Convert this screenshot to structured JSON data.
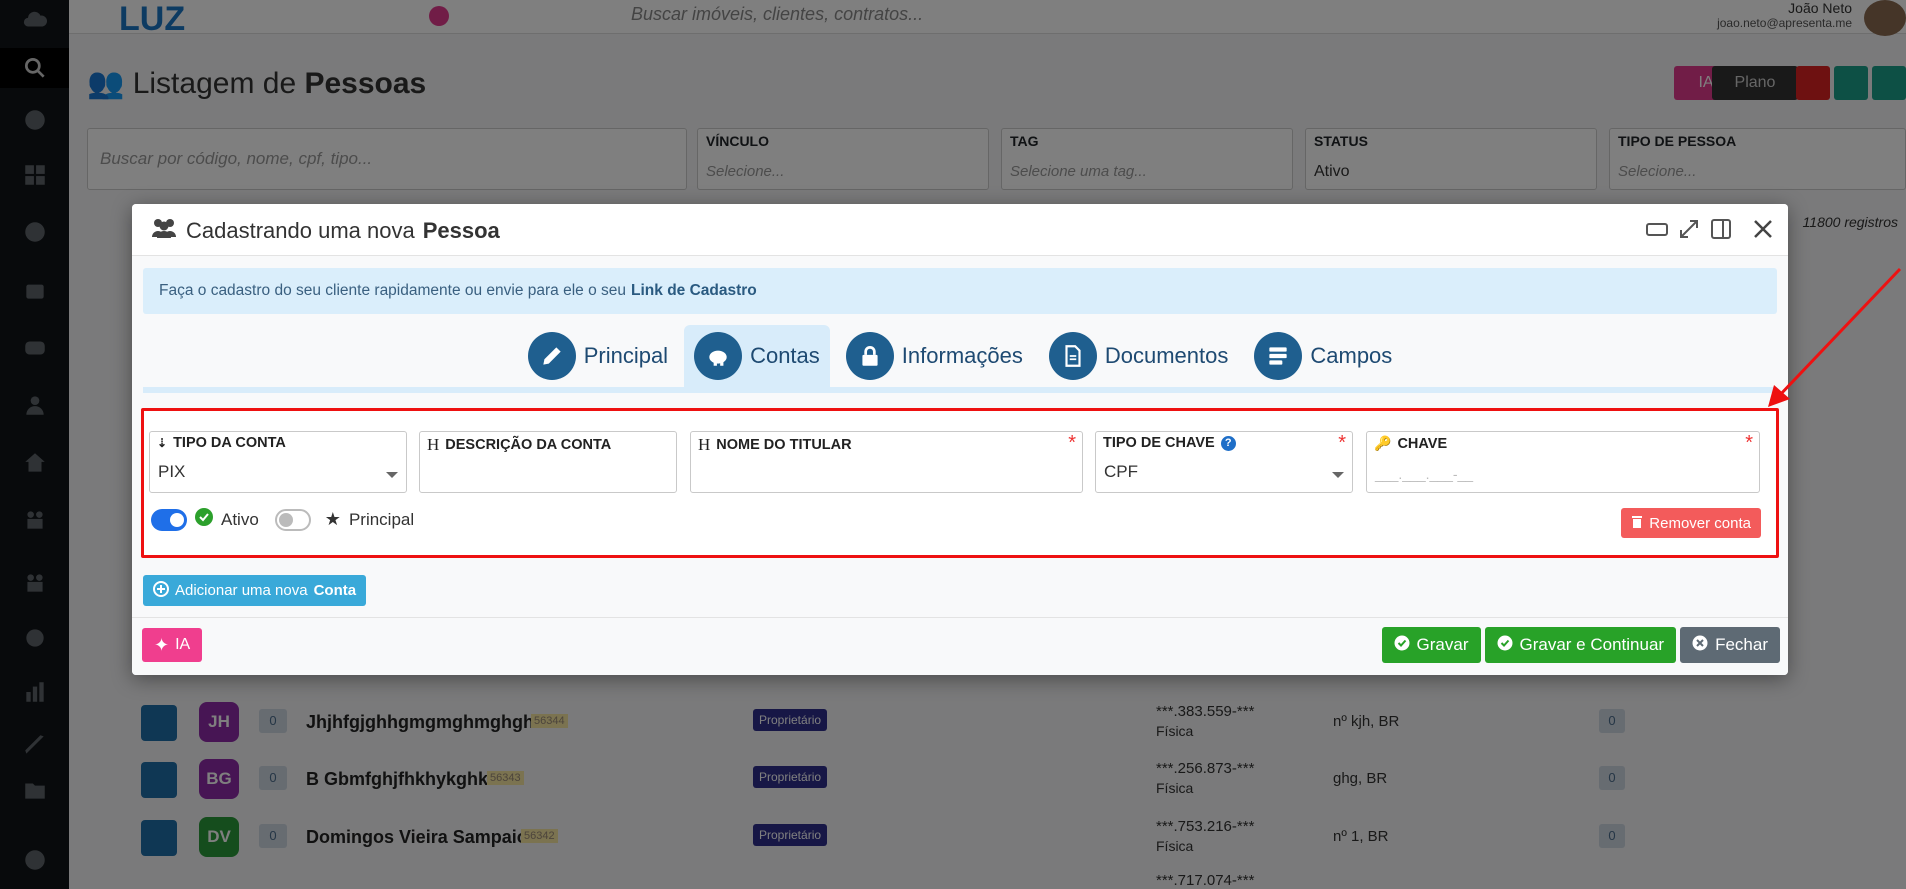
{
  "topbar": {
    "logo": "LUZ",
    "search_placeholder": "Buscar imóveis, clientes, contratos...",
    "user_name": "João Neto",
    "user_email": "joao.neto@apresenta.me"
  },
  "page": {
    "title_prefix": "Listagem de",
    "title_bold": "Pessoas",
    "actions": {
      "ia": "IA",
      "plano": "Plano"
    },
    "search_placeholder": "Buscar por código, nome, cpf, tipo...",
    "filters": [
      {
        "label": "VÍNCULO",
        "value": "Selecione..."
      },
      {
        "label": "TAG",
        "value": "Selecione uma tag..."
      },
      {
        "label": "STATUS",
        "value": "Ativo"
      },
      {
        "label": "TIPO DE PESSOA",
        "value": "Selecione..."
      }
    ],
    "registros": "11800 registros"
  },
  "bg_rows": [
    {
      "initials": "JH",
      "color": "#8e2aa8",
      "count": "0",
      "name": "Jhjhfgjghhgmgmghmghgh",
      "code": "56344",
      "badge": "Proprietário",
      "doc": "***.383.559-***",
      "tipo": "Física",
      "address": "nº kjh, BR",
      "n": "0"
    },
    {
      "initials": "BG",
      "color": "#8e2aa8",
      "count": "0",
      "name": "B Gbmfghjfhkhykghkk",
      "code": "56343",
      "badge": "Proprietário",
      "doc": "***.256.873-***",
      "tipo": "Física",
      "address": "ghg, BR",
      "n": "0"
    },
    {
      "initials": "DV",
      "color": "#2a9a3a",
      "count": "0",
      "name": "Domingos Vieira Sampaio",
      "code": "56342",
      "badge": "Proprietário",
      "doc": "***.753.216-***",
      "tipo": "Física",
      "address": "nº 1, BR",
      "n": "0"
    }
  ],
  "bg_last_doc": "***.717.074-***",
  "modal": {
    "title_prefix": "Cadastrando uma nova",
    "title_bold": "Pessoa",
    "banner_text": "Faça o cadastro do seu cliente rapidamente ou envie para ele o seu",
    "banner_link": "Link de Cadastro",
    "tabs": [
      {
        "label": "Principal",
        "icon": "pencil-icon"
      },
      {
        "label": "Contas",
        "icon": "piggy-bank-icon"
      },
      {
        "label": "Informações",
        "icon": "lock-icon"
      },
      {
        "label": "Documentos",
        "icon": "document-icon"
      },
      {
        "label": "Campos",
        "icon": "database-icon"
      }
    ],
    "account": {
      "tipo_conta": {
        "label": "TIPO DA CONTA",
        "value": "PIX"
      },
      "descricao": {
        "label": "DESCRIÇÃO DA CONTA",
        "value": ""
      },
      "titular": {
        "label": "NOME DO TITULAR",
        "value": ""
      },
      "tipo_chave": {
        "label": "TIPO DE CHAVE",
        "value": "CPF"
      },
      "chave": {
        "label": "CHAVE",
        "placeholder": "___.___.___-__"
      },
      "ativo_label": "Ativo",
      "principal_label": "Principal",
      "remove_label": "Remover conta"
    },
    "add_prefix": "Adicionar uma nova",
    "add_bold": "Conta",
    "footer": {
      "ia": "IA",
      "gravar": "Gravar",
      "gravar_continuar": "Gravar e Continuar",
      "fechar": "Fechar"
    }
  }
}
